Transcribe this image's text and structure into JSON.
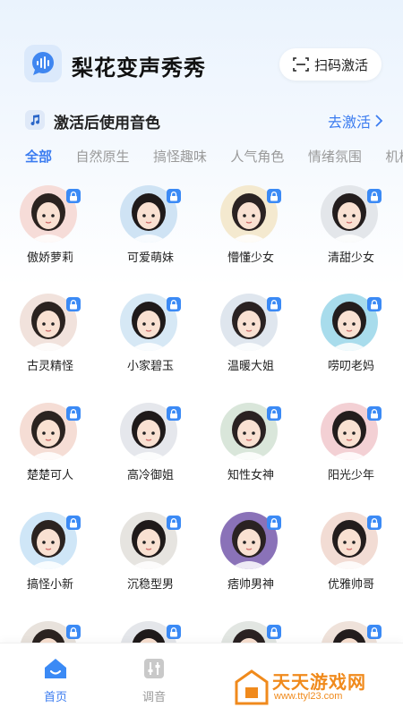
{
  "header": {
    "app_title": "梨花变声秀秀",
    "scan_button_label": "扫码激活",
    "logo_icon": "voice-wave-chat-icon"
  },
  "notice": {
    "text": "激活后使用音色",
    "link_label": "去激活",
    "icon": "music-note-icon"
  },
  "tabs": [
    {
      "label": "全部",
      "active": true
    },
    {
      "label": "自然原生",
      "active": false
    },
    {
      "label": "搞怪趣味",
      "active": false
    },
    {
      "label": "人气角色",
      "active": false
    },
    {
      "label": "情绪氛围",
      "active": false
    },
    {
      "label": "机械",
      "active": false
    }
  ],
  "voices": [
    {
      "name": "傲娇萝莉",
      "locked": true,
      "bg": "#f6dcd8"
    },
    {
      "name": "可爱萌妹",
      "locked": true,
      "bg": "#cfe3f4"
    },
    {
      "name": "懵懂少女",
      "locked": true,
      "bg": "#f4e9cf"
    },
    {
      "name": "清甜少女",
      "locked": true,
      "bg": "#e3e6ea"
    },
    {
      "name": "古灵精怪",
      "locked": true,
      "bg": "#f1e2dc"
    },
    {
      "name": "小家碧玉",
      "locked": true,
      "bg": "#d6e8f5"
    },
    {
      "name": "温暖大姐",
      "locked": true,
      "bg": "#dfe6ee"
    },
    {
      "name": "唠叨老妈",
      "locked": true,
      "bg": "#a8dcec"
    },
    {
      "name": "楚楚可人",
      "locked": true,
      "bg": "#f5ddd5"
    },
    {
      "name": "高冷御姐",
      "locked": true,
      "bg": "#e5e7ec"
    },
    {
      "name": "知性女神",
      "locked": true,
      "bg": "#d9e6da"
    },
    {
      "name": "阳光少年",
      "locked": true,
      "bg": "#f3d0d4"
    },
    {
      "name": "搞怪小新",
      "locked": true,
      "bg": "#cfe6f7"
    },
    {
      "name": "沉稳型男",
      "locked": true,
      "bg": "#e6e4e0"
    },
    {
      "name": "痞帅男神",
      "locked": true,
      "bg": "#8a72b8"
    },
    {
      "name": "优雅帅哥",
      "locked": true,
      "bg": "#f2dcd4"
    },
    {
      "name": "",
      "locked": true,
      "bg": "#e8e2dc"
    },
    {
      "name": "",
      "locked": true,
      "bg": "#e4e6ea"
    },
    {
      "name": "",
      "locked": true,
      "bg": "#e2e6e2"
    },
    {
      "name": "",
      "locked": true,
      "bg": "#efe2da"
    }
  ],
  "bottom_nav": [
    {
      "label": "首页",
      "icon": "home-icon",
      "active": true
    },
    {
      "label": "调音",
      "icon": "equalizer-icon",
      "active": false
    }
  ],
  "watermark": {
    "title": "天天游戏网",
    "url": "www.ttyl23.com"
  },
  "colors": {
    "accent": "#3b7cf0",
    "inactive": "#9a9a9a",
    "watermark": "#f08a1c"
  }
}
